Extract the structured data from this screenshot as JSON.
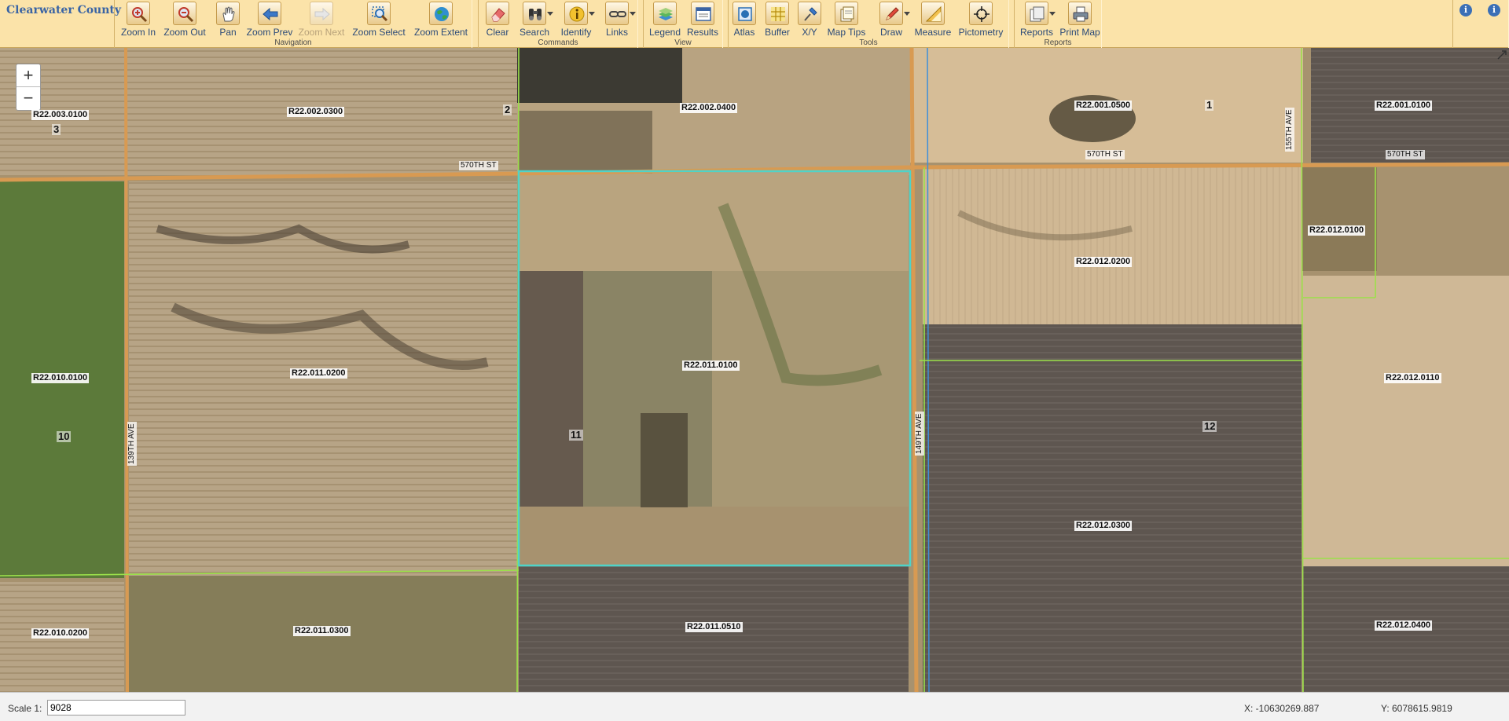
{
  "app": {
    "title": "Clearwater County"
  },
  "toolbar": {
    "groups": [
      {
        "label": "Navigation",
        "tools": [
          {
            "label": "Zoom In",
            "icon": "zoom-in-icon"
          },
          {
            "label": "Zoom Out",
            "icon": "zoom-out-icon"
          },
          {
            "label": "Pan",
            "icon": "pan-hand-icon"
          },
          {
            "label": "Zoom Prev",
            "icon": "arrow-left-icon"
          },
          {
            "label": "Zoom Next",
            "icon": "arrow-right-icon",
            "disabled": true
          },
          {
            "label": "Zoom Select",
            "icon": "zoom-select-icon"
          },
          {
            "label": "Zoom Extent",
            "icon": "globe-icon"
          }
        ]
      },
      {
        "label": "Commands",
        "tools": [
          {
            "label": "Clear",
            "icon": "eraser-icon"
          },
          {
            "label": "Search",
            "icon": "binoculars-icon"
          },
          {
            "label": "Identify",
            "icon": "identify-icon"
          },
          {
            "label": "Links",
            "icon": "chain-link-icon"
          }
        ]
      },
      {
        "label": "View",
        "tools": [
          {
            "label": "Legend",
            "icon": "legend-layers-icon"
          },
          {
            "label": "Results",
            "icon": "results-window-icon"
          }
        ]
      },
      {
        "label": "Tools",
        "tools": [
          {
            "label": "Atlas",
            "icon": "atlas-icon"
          },
          {
            "label": "Buffer",
            "icon": "buffer-grid-icon"
          },
          {
            "label": "X/Y",
            "icon": "pushpin-icon"
          },
          {
            "label": "Map Tips",
            "icon": "map-tips-icon"
          },
          {
            "label": "Draw",
            "icon": "pencil-icon"
          },
          {
            "label": "Measure",
            "icon": "ruler-triangle-icon"
          },
          {
            "label": "Pictometry",
            "icon": "crosshair-icon"
          }
        ]
      },
      {
        "label": "Reports",
        "tools": [
          {
            "label": "Reports",
            "icon": "reports-icon"
          },
          {
            "label": "Print Map",
            "icon": "printer-icon"
          }
        ]
      }
    ]
  },
  "map": {
    "zoom_in": "+",
    "zoom_out": "−",
    "parcels": [
      "R22.003.0100",
      "R22.002.0300",
      "R22.002.0400",
      "R22.001.0500",
      "R22.001.0100",
      "R22.012.0100",
      "R22.012.0200",
      "R22.010.0100",
      "R22.011.0200",
      "R22.011.0100",
      "R22.012.0110",
      "R22.012.0300",
      "R22.010.0200",
      "R22.011.0300",
      "R22.011.0510",
      "R22.012.0400"
    ],
    "sections": [
      "3",
      "2",
      "1",
      "10",
      "11",
      "12"
    ],
    "roads": [
      "570TH ST",
      "570TH ST",
      "570TH ST",
      "139TH AVE",
      "149TH AVE",
      "155TH AVE"
    ]
  },
  "status": {
    "scale_label": "Scale 1:",
    "scale_value": "9028",
    "x_coord": "X: -10630269.887",
    "y_coord": "Y: 6078615.9819"
  },
  "colors": {
    "toolbar_bg": "#fbe3a9",
    "brand": "#3a64a4",
    "selection": "#4fd3c8",
    "parcel_line": "#9be04a",
    "road": "#d89a52"
  }
}
